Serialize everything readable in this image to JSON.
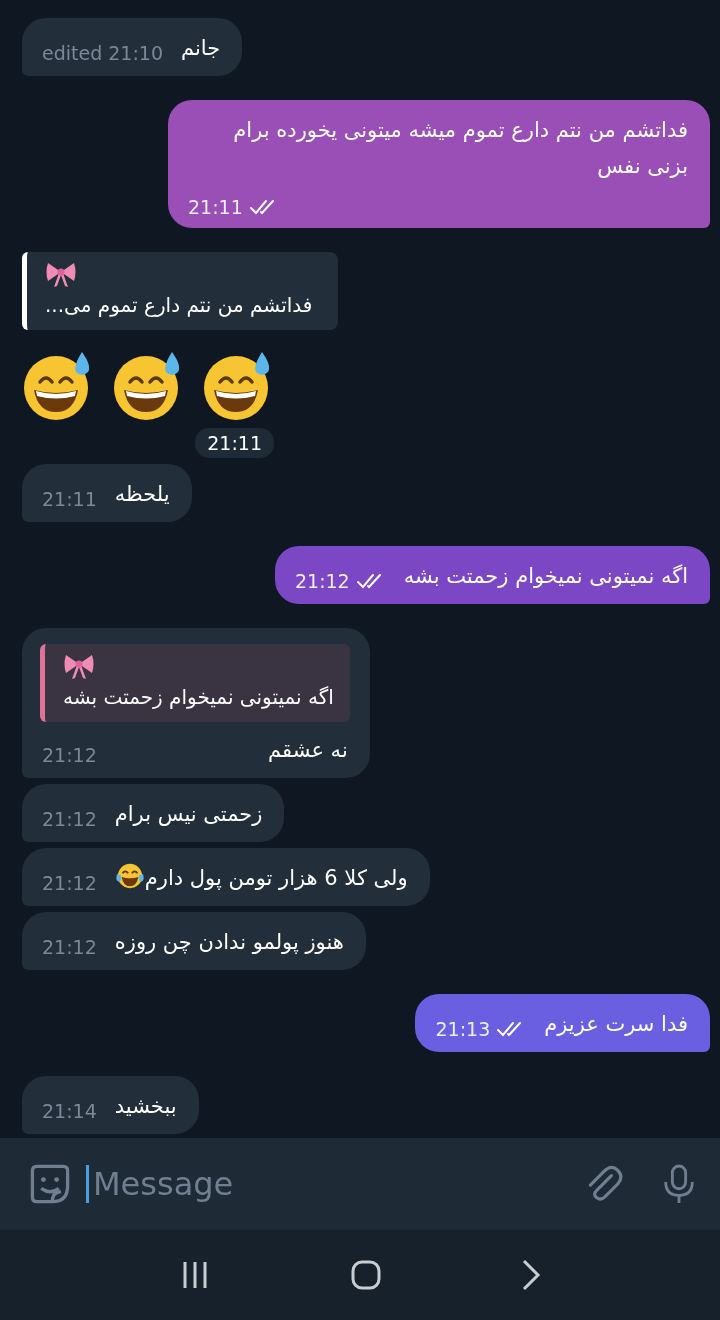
{
  "messages": [
    {
      "kind": "text",
      "outgoing": false,
      "text": "جانم",
      "edited": "edited",
      "time": "21:10"
    },
    {
      "kind": "text",
      "outgoing": true,
      "color": "#9a4fb6",
      "text": "فداتشم من نتم دارع تموم میشه میتونی یخورده برام بزنی نفس",
      "time": "21:11",
      "read": true
    },
    {
      "kind": "emoji",
      "outgoing": false,
      "reply": {
        "text": "فداتشم من نتم دارع تموم می...",
        "color": "#ffffff"
      },
      "emojis": [
        {
          "kind": "sweat-smile"
        },
        {
          "kind": "sweat-smile"
        },
        {
          "kind": "sweat-smile"
        }
      ],
      "time": "21:11"
    },
    {
      "kind": "text",
      "outgoing": false,
      "text": "یلحظه",
      "time": "21:11"
    },
    {
      "kind": "text",
      "outgoing": true,
      "color": "#7b47c5",
      "text": "اگه نمیتونی نمیخوام زحمتت بشه",
      "time": "21:12",
      "read": true
    },
    {
      "kind": "text",
      "outgoing": false,
      "reply": {
        "text": "اگه نمیتونی نمیخوام زحمتت بشه",
        "color": "#e0729a"
      },
      "text": "نه عشقم",
      "time": "21:12"
    },
    {
      "kind": "text",
      "outgoing": false,
      "text": "زحمتی نیس برام",
      "time": "21:12"
    },
    {
      "kind": "text",
      "outgoing": false,
      "text": "ولی کلا 6 هزار تومن پول دارم",
      "inline_emoji": {
        "kind": "tears-of-joy"
      },
      "time": "21:12"
    },
    {
      "kind": "text",
      "outgoing": false,
      "text": "هنوز پولمو ندادن چن روزه",
      "time": "21:12"
    },
    {
      "kind": "text",
      "outgoing": true,
      "color": "#6a5fe0",
      "text": "فدا سرت عزیزم",
      "time": "21:13",
      "read": true
    },
    {
      "kind": "text",
      "outgoing": false,
      "text": "ببخشید",
      "time": "21:14"
    }
  ],
  "composer": {
    "placeholder": "Message"
  }
}
